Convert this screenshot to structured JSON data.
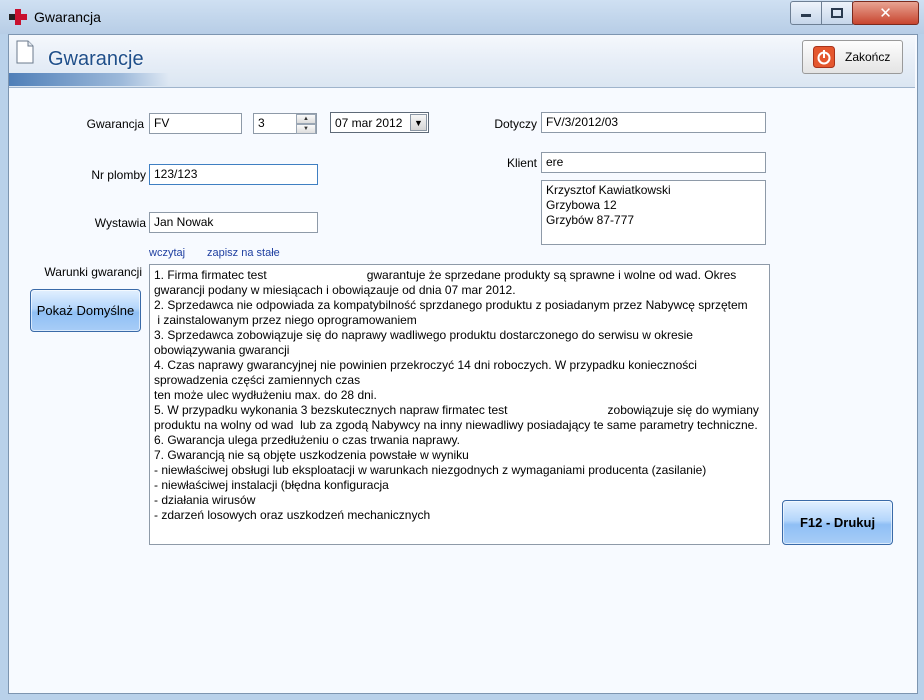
{
  "window": {
    "title": "Gwarancja"
  },
  "header": {
    "title": "Gwarancje",
    "exit_label": "Zakończ"
  },
  "form": {
    "gwarancja_label": "Gwarancja",
    "gwarancja_value": "FV",
    "spin_value": "3",
    "date_value": "07 mar 2012",
    "nr_plomby_label": "Nr plomby",
    "nr_plomby_value": "123/123",
    "wystawia_label": "Wystawia",
    "wystawia_value": "Jan Nowak",
    "dotyczy_label": "Dotyczy",
    "dotyczy_value": "FV/3/2012/03",
    "klient_label": "Klient",
    "klient_value": "ere",
    "klient_address": "Krzysztof Kawiatkowski\nGrzybowa 12\nGrzybów 87-777",
    "load_link": "wczytaj",
    "save_link": "zapisz na stałe",
    "terms_label": "Warunki gwarancji",
    "defaults_button": "Pokaż Domyślne",
    "print_button": "F12 - Drukuj",
    "terms_text": "1. Firma firmatec test                              gwarantuje że sprzedane produkty są sprawne i wolne od wad. Okres gwarancji podany w miesiącach i obowiązauje od dnia 07 mar 2012.\n2. Sprzedawca nie odpowiada za kompatybilność sprzdanego produktu z posiadanym przez Nabywcę sprzętem\n i zainstalowanym przez niego oprogramowaniem\n3. Sprzedawca zobowiązuje się do naprawy wadliwego produktu dostarczonego do serwisu w okresie obowiązywania gwarancji\n4. Czas naprawy gwarancyjnej nie powinien przekroczyć 14 dni roboczych. W przypadku konieczności sprowadzenia części zamiennych czas\nten może ulec wydłużeniu max. do 28 dni.\n5. W przypadku wykonania 3 bezskutecznych napraw firmatec test                              zobowiązuje się do wymiany produktu na wolny od wad  lub za zgodą Nabywcy na inny niewadliwy posiadający te same parametry techniczne.\n6. Gwarancja ulega przedłużeniu o czas trwania naprawy.\n7. Gwarancją nie są objęte uszkodzenia powstałe w wyniku\n- niewłaściwej obsługi lub eksploatacji w warunkach niezgodnych z wymaganiami producenta (zasilanie)\n- niewłaściwej instalacji (błędna konfiguracja\n- działania wirusów\n- zdarzeń losowych oraz uszkodzeń mechanicznych"
  },
  "colors": {
    "title_blue": "#1f4f8a",
    "button_blue": "#a8cdf7",
    "link_blue": "#1f3fa0"
  }
}
